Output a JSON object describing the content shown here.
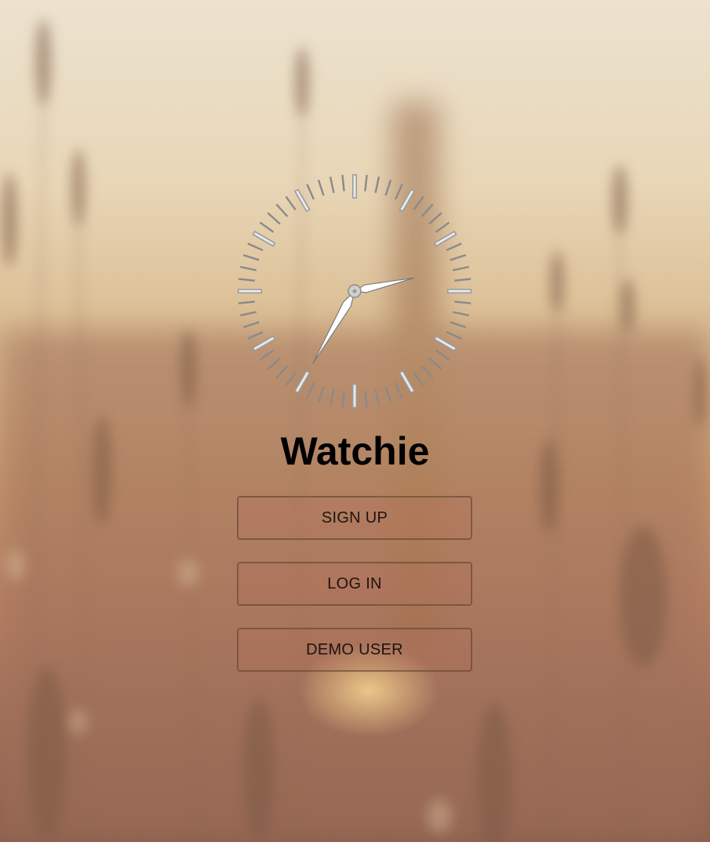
{
  "app": {
    "title": "Watchie"
  },
  "clock": {
    "hour": 2,
    "minute": 35,
    "second": 0,
    "hand_color": "#ffffff",
    "tick_color": "#8a8a8a"
  },
  "actions": {
    "sign_up_label": "SIGN UP",
    "log_in_label": "LOG IN",
    "demo_user_label": "DEMO USER"
  },
  "colors": {
    "title_text": "#000000",
    "button_text": "#1e1410"
  }
}
